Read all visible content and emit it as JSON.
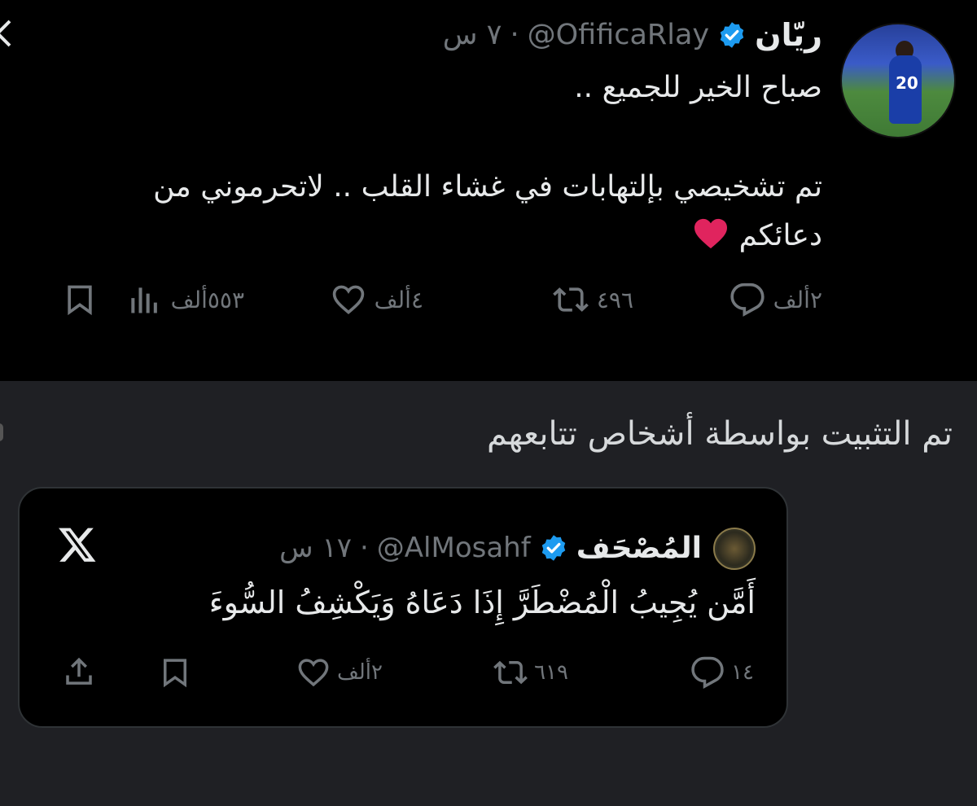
{
  "tweet": {
    "display_name": "ريّان",
    "handle": "@OfificaRlay",
    "time": "٧ س",
    "meta_separator": "·",
    "verified_icon": "verified-badge-icon",
    "lines": [
      "صباح الخير للجميع ..",
      "تم تشخيصي بإلتهابات في غشاء القلب .. لاتحرموني من",
      "دعائكم"
    ],
    "emoji": "red-heart-icon",
    "actions": {
      "replies": "٢ألف",
      "retweets": "٤٩٦",
      "likes": "٤ألف",
      "views": "٥٥٣ألف"
    }
  },
  "pinned": {
    "label": "تم التثبيت بواسطة أشخاص تتابعهم"
  },
  "quote": {
    "display_name": "المُصْحَف",
    "handle": "@AlMosahf",
    "time": "١٧ س",
    "meta_separator": "·",
    "text": "أَمَّن يُجِيبُ الْمُضْطَرَّ إِذَا دَعَاهُ وَيَكْشِفُ السُّوءَ",
    "actions": {
      "replies": "١٤",
      "retweets": "٦١٩",
      "likes": "٢ألف"
    }
  },
  "colors": {
    "background": "#1f2024",
    "tweet_bg": "#000000",
    "muted": "#71767b",
    "verified": "#1d9bf0",
    "heart": "#e0245e"
  }
}
